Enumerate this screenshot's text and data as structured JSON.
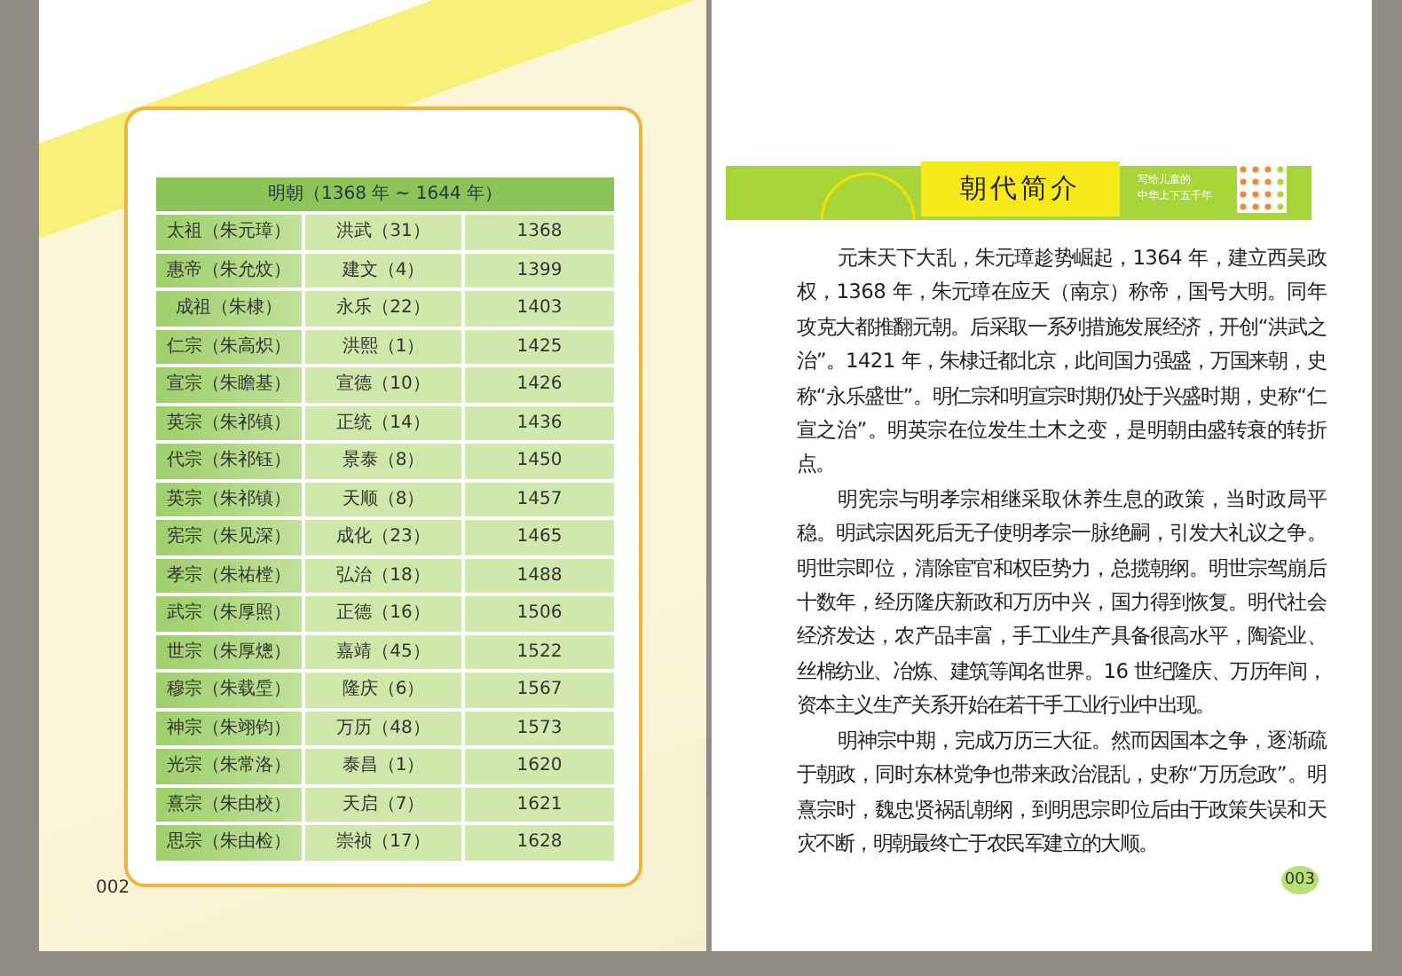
{
  "left_page": {
    "table": {
      "title": "明朝（1368 年 ~ 1644 年）",
      "rows": [
        [
          "太祖（朱元璋）",
          "洪武（31）",
          "1368"
        ],
        [
          "惠帝（朱允炆）",
          "建文（4）",
          "1399"
        ],
        [
          "成祖（朱棣）",
          "永乐（22）",
          "1403"
        ],
        [
          "仁宗（朱高炽）",
          "洪熙（1）",
          "1425"
        ],
        [
          "宣宗（朱瞻基）",
          "宣德（10）",
          "1426"
        ],
        [
          "英宗（朱祁镇）",
          "正统（14）",
          "1436"
        ],
        [
          "代宗（朱祁钰）",
          "景泰（8）",
          "1450"
        ],
        [
          "英宗（朱祁镇）",
          "天顺（8）",
          "1457"
        ],
        [
          "宪宗（朱见深）",
          "成化（23）",
          "1465"
        ],
        [
          "孝宗（朱祐樘）",
          "弘治（18）",
          "1488"
        ],
        [
          "武宗（朱厚照）",
          "正德（16）",
          "1506"
        ],
        [
          "世宗（朱厚熜）",
          "嘉靖（45）",
          "1522"
        ],
        [
          "穆宗（朱载垕）",
          "隆庆（6）",
          "1567"
        ],
        [
          "神宗（朱翊钧）",
          "万历（48）",
          "1573"
        ],
        [
          "光宗（朱常洛）",
          "泰昌（1）",
          "1620"
        ],
        [
          "熹宗（朱由校）",
          "天启（7）",
          "1621"
        ],
        [
          "思宗（朱由检）",
          "崇祯（17）",
          "1628"
        ]
      ]
    },
    "page_number": "002"
  },
  "right_page": {
    "banner": {
      "title": "朝代简介",
      "series_line_1": "写给儿童的",
      "series_line_2": "中华上下五千年"
    },
    "paragraphs": [
      "元末天下大乱，朱元璋趁势崛起，1364 年，建立西吴政权，1368 年，朱元璋在应天（南京）称帝，国号大明。同年攻克大都推翻元朝。后采取一系列措施发展经济，开创“洪武之治”。1421 年，朱棣迁都北京，此间国力强盛，万国来朝，史称“永乐盛世”。明仁宗和明宣宗时期仍处于兴盛时期，史称“仁宣之治”。明英宗在位发生土木之变，是明朝由盛转衰的转折点。",
      "明宪宗与明孝宗相继采取休养生息的政策，当时政局平稳。明武宗因死后无子使明孝宗一脉绝嗣，引发大礼议之争。明世宗即位，清除宦官和权臣势力，总揽朝纲。明世宗驾崩后十数年，经历隆庆新政和万历中兴，国力得到恢复。明代社会经济发达，农产品丰富，手工业生产具备很高水平，陶瓷业、丝棉纺业、冶炼、建筑等闻名世界。16 世纪隆庆、万历年间，资本主义生产关系开始在若干手工业行业中出现。",
      "明神宗中期，完成万历三大征。然而因国本之争，逐渐疏于朝政，同时东林党争也带来政治混乱，史称“万历怠政”。明熹宗时，魏忠贤祸乱朝纲，到明思宗即位后由于政策失误和天灾不断，明朝最终亡于农民军建立的大顺。"
    ],
    "page_number": "003"
  }
}
